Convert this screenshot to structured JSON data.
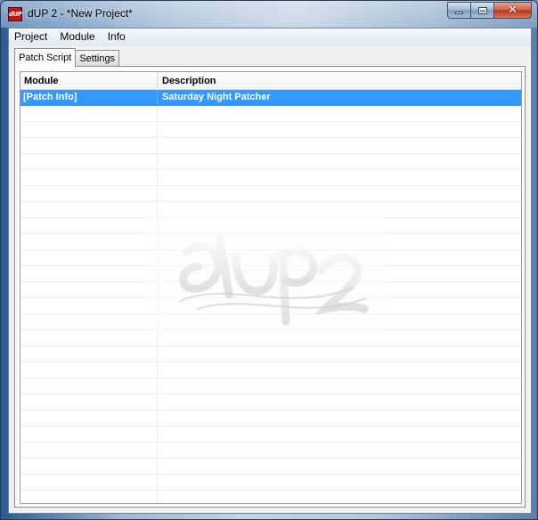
{
  "window": {
    "title": "dUP 2 - *New Project*",
    "icon": "dup-app-icon",
    "icon_label": "dUP"
  },
  "menubar": {
    "items": [
      "Project",
      "Module",
      "Info"
    ]
  },
  "tabs": [
    {
      "label": "Patch Script",
      "active": true
    },
    {
      "label": "Settings",
      "active": false
    }
  ],
  "table": {
    "columns": [
      "Module",
      "Description"
    ],
    "rows": [
      {
        "module": "[Patch Info]",
        "description": "Saturday Night Patcher",
        "selected": true
      }
    ]
  },
  "watermark": {
    "icon": "dup-graffiti-logo-watermark",
    "text": "dUP2"
  },
  "colors": {
    "selection": "#3399ff",
    "close_button": "#c7442a"
  }
}
